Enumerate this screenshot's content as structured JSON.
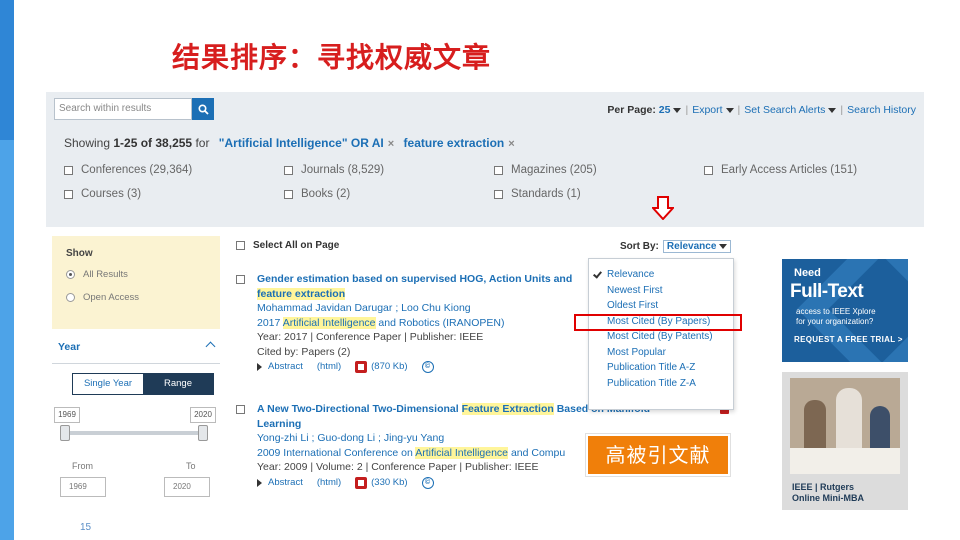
{
  "slide": {
    "title": "结果排序：寻找权威文章",
    "page_number": "15",
    "callout": "高被引文献",
    "accent_color": "#4da3e8",
    "highlight_color": "#e00000"
  },
  "toolbar": {
    "search_placeholder": "Search within results",
    "per_page_label": "Per Page:",
    "per_page_value": "25",
    "export": "Export",
    "set_search_alerts": "Set Search Alerts",
    "search_history": "Search History"
  },
  "summary": {
    "prefix": "Showing",
    "range": "1-25 of 38,255",
    "for": "for",
    "term1": "\"Artificial Intelligence\" OR AI",
    "term2": "feature extraction",
    "remove": "×"
  },
  "content_types": [
    {
      "label": "Conferences (29,364)"
    },
    {
      "label": "Journals (8,529)"
    },
    {
      "label": "Magazines (205)"
    },
    {
      "label": "Early Access Articles (151)"
    },
    {
      "label": "Courses (3)"
    },
    {
      "label": "Books (2)"
    },
    {
      "label": "Standards (1)"
    }
  ],
  "sidebar": {
    "show_title": "Show",
    "options": [
      "All Results",
      "Open Access"
    ],
    "year_title": "Year",
    "tabs": [
      "Single Year",
      "Range"
    ],
    "slider_min": "1969",
    "slider_max": "2020",
    "from_label": "From",
    "to_label": "To",
    "from_value": "1969",
    "to_value": "2020"
  },
  "list_header": {
    "select_all": "Select All on Page",
    "sort_by": "Sort By:",
    "sort_value": "Relevance"
  },
  "sort_options": [
    "Relevance",
    "Newest First",
    "Oldest First",
    "Most Cited (By Papers)",
    "Most Cited (By Patents)",
    "Most Popular",
    "Publication Title A-Z",
    "Publication Title Z-A"
  ],
  "results": [
    {
      "title_a": "Gender estimation based on supervised HOG, Action Units and",
      "title_b": "feature extraction",
      "authors": "Mohammad Javidan Darugar ; Loo Chu Kiong",
      "venue_pre": "2017",
      "venue_hl": "Artificial Intelligence",
      "venue_post": "and Robotics (IRANOPEN)",
      "meta": "Year: 2017 | Conference Paper | Publisher: IEEE",
      "cited": "Cited by: Papers (2)",
      "abstract": "Abstract",
      "html": "(html)",
      "pdf": "(870 Kb)"
    },
    {
      "title_a": "A New Two-Directional Two-Dimensional",
      "title_hl": "Feature Extraction",
      "title_b": "Based on Manifold",
      "title_c": "Learning",
      "authors": "Yong-zhi Li ; Guo-dong Li ; Jing-yu Yang",
      "venue_pre": "2009 International Conference on",
      "venue_hl": "Artificial Intelligence",
      "venue_post": "and Compu",
      "meta": "Year: 2009 | Volume: 2 | Conference Paper | Publisher: IEEE",
      "abstract": "Abstract",
      "html": "(html)",
      "pdf": "(330 Kb)"
    }
  ],
  "ads": {
    "ad1_line1": "Need",
    "ad1_line2": "Full-Text",
    "ad1_line3": "access to IEEE Xplore",
    "ad1_line4": "for your organization?",
    "ad1_cta": "REQUEST A FREE TRIAL  >",
    "ad2_line1": "IEEE | Rutgers",
    "ad2_line2": "Online Mini-MBA"
  }
}
